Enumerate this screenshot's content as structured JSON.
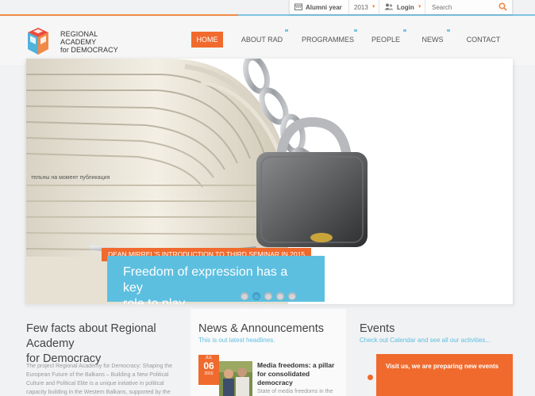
{
  "utility": {
    "alumni_label": "Alumni year",
    "alumni_value": "2013",
    "login_label": "Login",
    "search_placeholder": "Search"
  },
  "logo": {
    "line1": "REGIONAL ACADEMY",
    "line2": "for DEMOCRACY"
  },
  "nav": {
    "items": [
      {
        "label": "HOME",
        "active": true
      },
      {
        "label": "ABOUT RAD"
      },
      {
        "label": "PROGRAMMES"
      },
      {
        "label": "PEOPLE"
      },
      {
        "label": "NEWS"
      },
      {
        "label": "CONTACT"
      }
    ]
  },
  "hero": {
    "tag": "DEAN MIRREL'S INTRODUCTION TO THIRD SEMINAR IN 2015",
    "caption_line1": "Freedom of expression has a key",
    "caption_line2": "role to play",
    "paper_text": "тельны на момент публикация",
    "slides": 5,
    "active_slide": 2
  },
  "facts": {
    "title_line1": "Few facts about Regional Academy",
    "title_line2": "for Democracy",
    "text": [
      "The project Regional Academy for Democracy: Shaping the",
      "European Future of the Balkans – Building a New Political",
      "Culture and Political Elite is a unique initiative in political",
      "capacity building in the Western Balkans, supported by the"
    ]
  },
  "news": {
    "title": "News & Announcements",
    "subtitle": "This is out latest headlines.",
    "item": {
      "month": "JUL",
      "day": "06",
      "year": "2015",
      "headline_lines": [
        "Media freedoms: a pillar",
        "for consolidated",
        "democracy"
      ],
      "snippet": "State of media freedoms in the"
    }
  },
  "events": {
    "title": "Events",
    "subtitle": "Check out Calendar and see all our activities...",
    "notice": "Visit us, we are preparing new events"
  },
  "colors": {
    "accent_orange": "#f06a2d",
    "accent_blue": "#5dbfe0",
    "background": "#f1f2f4"
  }
}
